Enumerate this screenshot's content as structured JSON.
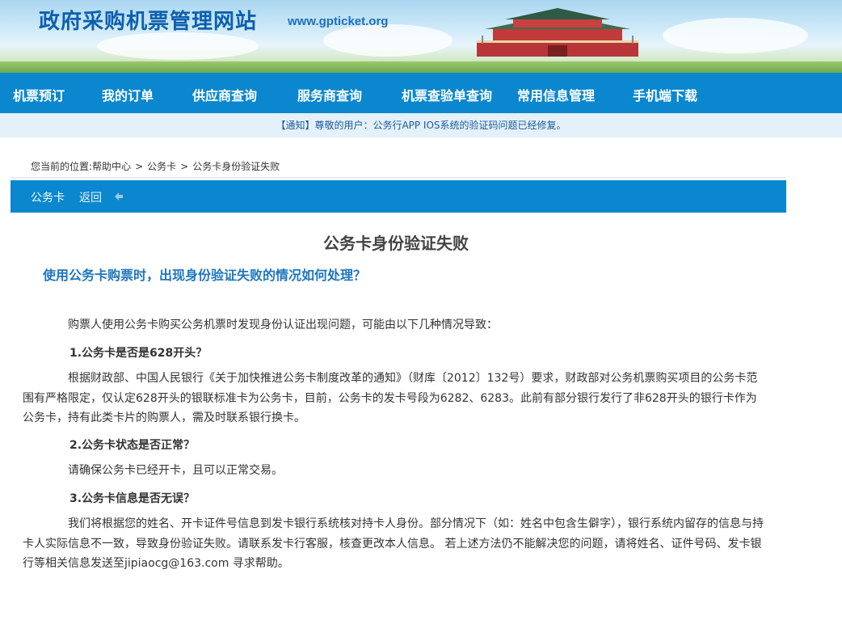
{
  "header": {
    "site_title": "政府采购机票管理网站",
    "site_url": "www.gpticket.org"
  },
  "nav": {
    "items": [
      {
        "label": "机票预订"
      },
      {
        "label": "我的订单"
      },
      {
        "label": "供应商查询"
      },
      {
        "label": "服务商查询"
      },
      {
        "label": "机票查验单查询"
      },
      {
        "label": "常用信息管理"
      },
      {
        "label": "手机端下载"
      }
    ]
  },
  "notice": {
    "text": "【通知】尊敬的用户：公务行APP IOS系统的验证码问题已经修复。"
  },
  "breadcrumb": {
    "prefix": "您当前的位置:",
    "items": [
      "帮助中心",
      "公务卡",
      "公务卡身份验证失败"
    ],
    "separator": ">"
  },
  "section": {
    "title": "公务卡",
    "back_label": "返回"
  },
  "article": {
    "title": "公务卡身份验证失败",
    "question": "使用公务卡购票时，出现身份验证失败的情况如何处理？",
    "intro": "购票人使用公务卡购买公务机票时发现身份认证出现问题，可能由以下几种情况导致：",
    "sections": [
      {
        "heading": "1.公务卡是否是628开头？",
        "body": "根据财政部、中国人民银行《关于加快推进公务卡制度改革的通知》（财库〔2012〕132号）要求，财政部对公务机票购买项目的公务卡范围有严格限定，仅认定628开头的银联标准卡为公务卡，目前，公务卡的发卡号段为6282、6283。此前有部分银行发行了非628开头的银行卡作为公务卡，持有此类卡片的购票人，需及时联系银行换卡。"
      },
      {
        "heading": "2.公务卡状态是否正常？",
        "body": "请确保公务卡已经开卡，且可以正常交易。"
      },
      {
        "heading": "3.公务卡信息是否无误？",
        "body": "我们将根据您的姓名、开卡证件号信息到发卡银行系统核对持卡人身份。部分情况下（如：姓名中包含生僻字），银行系统内留存的信息与持卡人实际信息不一致，导致身份验证失败。请联系发卡行客服，核查更改本人信息。  若上述方法仍不能解决您的问题，请将姓名、证件号码、发卡银行等相关信息发送至jipiaocg@163.com 寻求帮助。"
      }
    ]
  },
  "colors": {
    "nav_bg": "#0a87cf",
    "title_blue": "#0d5fae",
    "question_blue": "#1d76be",
    "notice_bg": "#e4f1fb"
  }
}
